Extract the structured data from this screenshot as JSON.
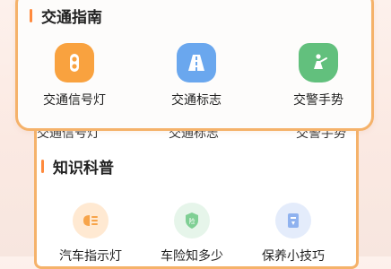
{
  "guide": {
    "title": "交通指南",
    "items": [
      {
        "label": "交通信号灯",
        "icon": "traffic-light-icon"
      },
      {
        "label": "交通标志",
        "icon": "road-sign-icon"
      },
      {
        "label": "交警手势",
        "icon": "police-gesture-icon"
      }
    ]
  },
  "knowledge": {
    "title": "知识科普",
    "items": [
      {
        "label": "汽车指示灯",
        "icon": "headlight-icon"
      },
      {
        "label": "车险知多少",
        "icon": "insurance-shield-icon"
      },
      {
        "label": "保养小技巧",
        "icon": "maintenance-icon"
      }
    ]
  },
  "colors": {
    "accent": "#ff8a3d",
    "frame": "#f5b26a"
  }
}
